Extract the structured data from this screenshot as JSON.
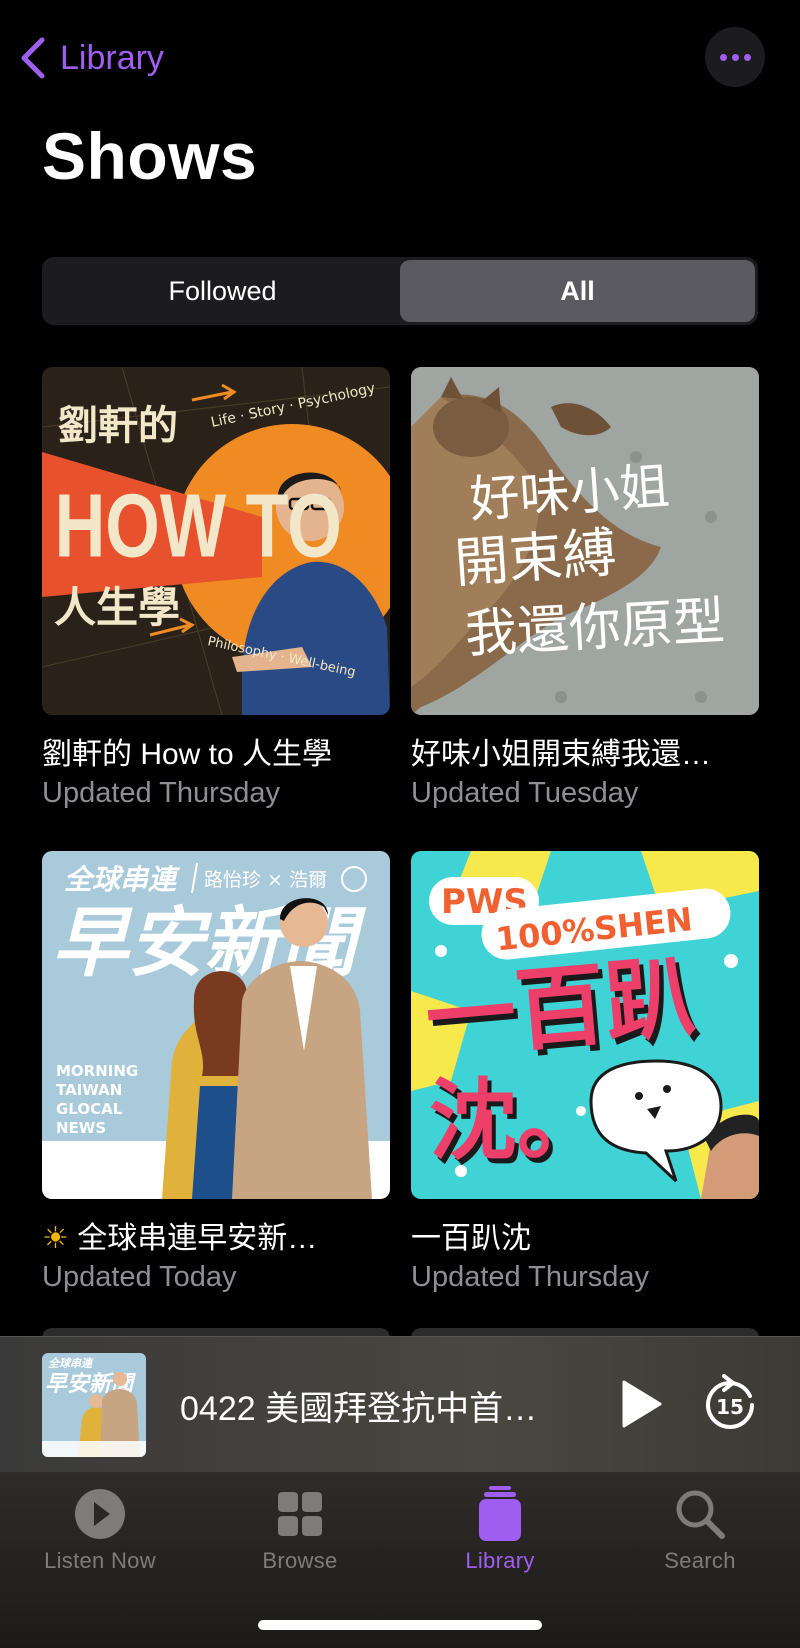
{
  "nav": {
    "back_label": "Library"
  },
  "page": {
    "title": "Shows"
  },
  "segments": [
    {
      "label": "Followed",
      "active": false
    },
    {
      "label": "All",
      "active": true
    }
  ],
  "shows": [
    {
      "title": "劉軒的 How to 人生學",
      "updated": "Updated Thursday",
      "art": {
        "l1": "劉軒的",
        "l2": "HOW TO",
        "l3": "人生學",
        "tag1": "Life · Story · Psychology",
        "tag2": "Philosophy · Well-being"
      }
    },
    {
      "title": "好味小姐開束縛我還…",
      "updated": "Updated Tuesday",
      "art": {
        "l1": "好味小姐",
        "l2": "開束縛",
        "l3": "我還你原型"
      }
    },
    {
      "title_icon": "☀",
      "title": "全球串連早安新…",
      "updated": "Updated Today",
      "art": {
        "top": "全球串連",
        "hosts": "路怡珍 × 浩爾",
        "big": "早安新聞",
        "side1": "MORNING",
        "side2": "TAIWAN",
        "side3": "GLOCAL",
        "side4": "NEWS"
      }
    },
    {
      "title": "一百趴沈",
      "updated": "Updated Thursday",
      "art": {
        "t1": "PWS",
        "t2": "100%SHEN",
        "big1": "一百趴",
        "big2": "沈。"
      }
    }
  ],
  "now_playing": {
    "title": "0422 美國拜登抗中首…",
    "art_top": "全球串連",
    "art_big": "早安新聞",
    "skip_seconds": "15"
  },
  "tabs": [
    {
      "label": "Listen Now",
      "active": false
    },
    {
      "label": "Browse",
      "active": false
    },
    {
      "label": "Library",
      "active": true
    },
    {
      "label": "Search",
      "active": false
    }
  ],
  "colors": {
    "accent": "#a05ef0",
    "secondary_text": "#8e8e93",
    "background": "#000000"
  }
}
